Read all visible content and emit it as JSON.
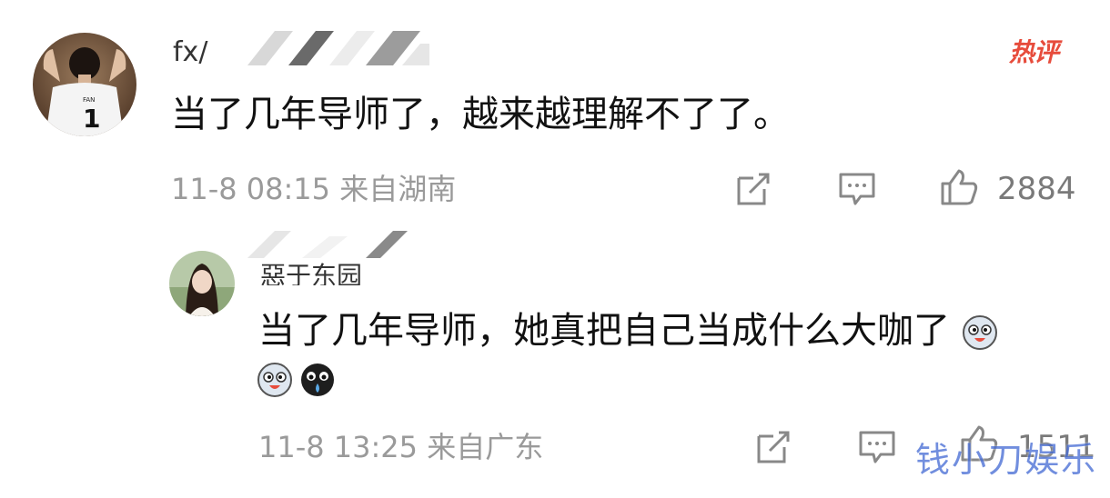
{
  "comment": {
    "username_visible": "fx/",
    "badge": "热评",
    "text": "当了几年导师了，越来越理解不了了。",
    "time": "11-8 08:15",
    "location": "来自湖南",
    "like_count": "2884",
    "avatar_shirt_name": "FAN",
    "avatar_shirt_number": "1"
  },
  "reply": {
    "username_visible": "惡于东园",
    "text": "当了几年导师，她真把自己当成什么大咖了",
    "time": "11-8 13:25",
    "location": "来自广东",
    "like_count": "1511"
  },
  "watermark": "钱小刀娱乐",
  "colors": {
    "hot_badge": "#e74c3c",
    "meta_gray": "#9a9a9a",
    "watermark_blue": "#4a6fd6"
  },
  "icons": {
    "share": "share-icon",
    "comment": "comment-icon",
    "like": "thumbs-up-icon",
    "emoji_husky": "husky-emoji-icon",
    "emoji_cry": "crying-emoji-icon"
  }
}
